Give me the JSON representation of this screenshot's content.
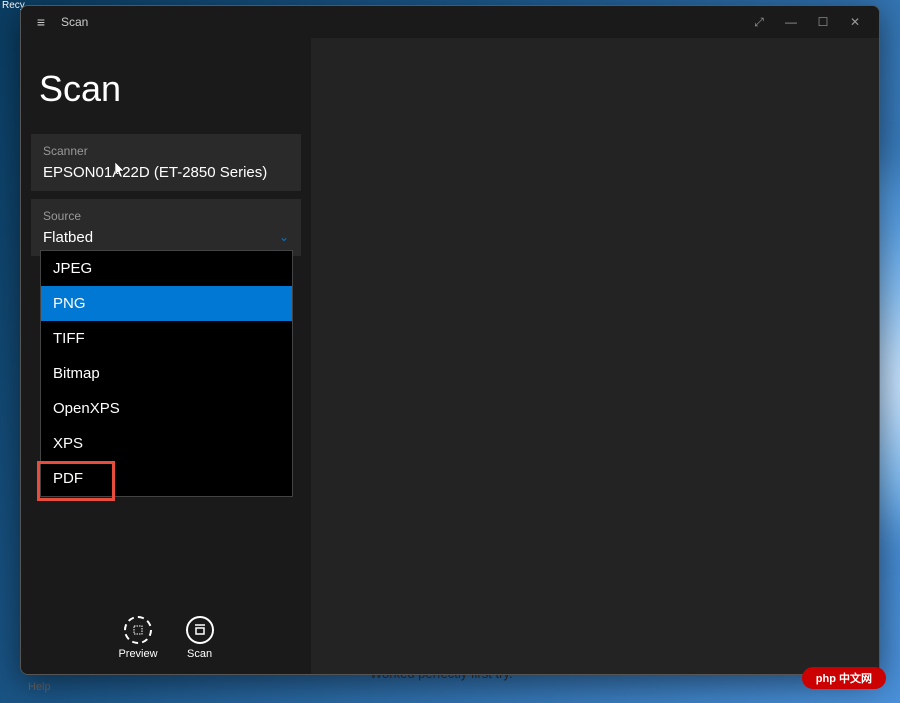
{
  "window": {
    "title": "Scan",
    "controls": {
      "diagonal": "⤢",
      "minimize": "—",
      "maximize": "☐",
      "close": "✕"
    }
  },
  "app": {
    "title": "Scan"
  },
  "scanner": {
    "label": "Scanner",
    "value": "EPSON01A22D (ET-2850 Series)"
  },
  "source": {
    "label": "Source",
    "value": "Flatbed"
  },
  "filetype_dropdown": {
    "options": [
      {
        "label": "JPEG",
        "selected": false
      },
      {
        "label": "PNG",
        "selected": true
      },
      {
        "label": "TIFF",
        "selected": false
      },
      {
        "label": "Bitmap",
        "selected": false
      },
      {
        "label": "OpenXPS",
        "selected": false
      },
      {
        "label": "XPS",
        "selected": false
      },
      {
        "label": "PDF",
        "selected": false,
        "highlighted": true
      }
    ]
  },
  "actions": {
    "preview": "Preview",
    "scan": "Scan"
  },
  "desktop": {
    "recycle": "Recy",
    "help": "Help"
  },
  "watermark": "php 中文网",
  "underneath": "Worked perfectly first try."
}
